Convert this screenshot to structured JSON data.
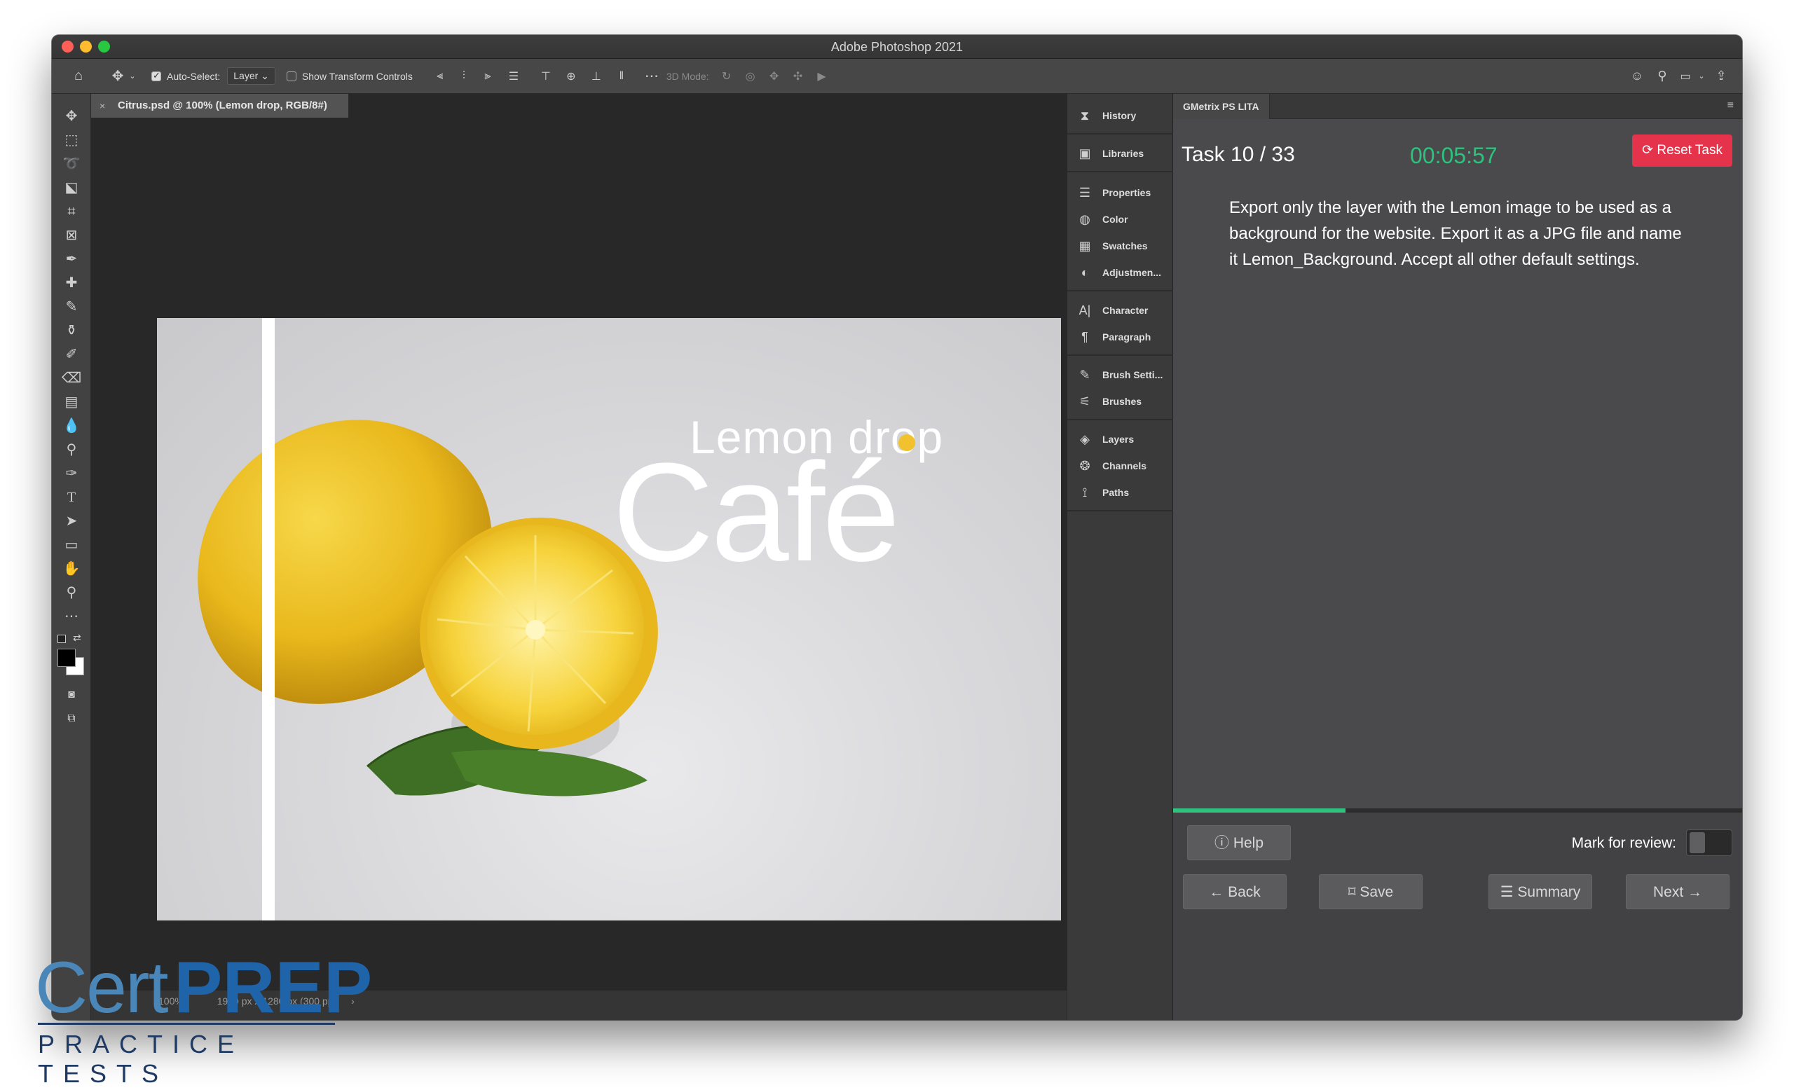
{
  "window": {
    "title": "Adobe Photoshop 2021"
  },
  "options_bar": {
    "auto_select_label": "Auto-Select:",
    "auto_select_value": "Layer",
    "show_transform_label": "Show Transform Controls",
    "mode_3d_label": "3D Mode:"
  },
  "document": {
    "tab_title": "Citrus.psd @ 100% (Lemon drop, RGB/8#)",
    "status_zoom": "100%",
    "status_info": "1920 px x 1280 px (300 ppi)",
    "artwork": {
      "line1": "Lemon drop",
      "line2": "Café"
    }
  },
  "dock": {
    "items": [
      {
        "label": "History",
        "icon": "history-icon"
      },
      {
        "label": "Libraries",
        "icon": "libraries-icon"
      },
      {
        "label": "Properties",
        "icon": "properties-icon"
      },
      {
        "label": "Color",
        "icon": "color-icon"
      },
      {
        "label": "Swatches",
        "icon": "swatches-icon"
      },
      {
        "label": "Adjustmen...",
        "icon": "adjustments-icon"
      },
      {
        "label": "Character",
        "icon": "character-icon"
      },
      {
        "label": "Paragraph",
        "icon": "paragraph-icon"
      },
      {
        "label": "Brush Setti...",
        "icon": "brush-settings-icon"
      },
      {
        "label": "Brushes",
        "icon": "brushes-icon"
      },
      {
        "label": "Layers",
        "icon": "layers-icon"
      },
      {
        "label": "Channels",
        "icon": "channels-icon"
      },
      {
        "label": "Paths",
        "icon": "paths-icon"
      }
    ]
  },
  "gmetrix": {
    "tab": "GMetrix PS LITA",
    "task": "Task 10 / 33",
    "timer": "00:05:57",
    "reset_label": "Reset Task",
    "instruction": "Export only the layer with the Lemon image to be used as a background for the website. Export it as a JPG file and name it Lemon_Background. Accept all other default settings.",
    "progress_fraction": 0.303,
    "help_label": "Help",
    "mark_review_label": "Mark for review:",
    "back_label": "Back",
    "save_label": "Save",
    "summary_label": "Summary",
    "next_label": "Next"
  },
  "logo": {
    "cert": "Cert",
    "prep": "PREP",
    "tagline": "PRACTICE TESTS"
  },
  "colors": {
    "accent_green": "#2ec27e",
    "reset_red": "#e5334b",
    "logo_blue": "#1f63a8"
  }
}
